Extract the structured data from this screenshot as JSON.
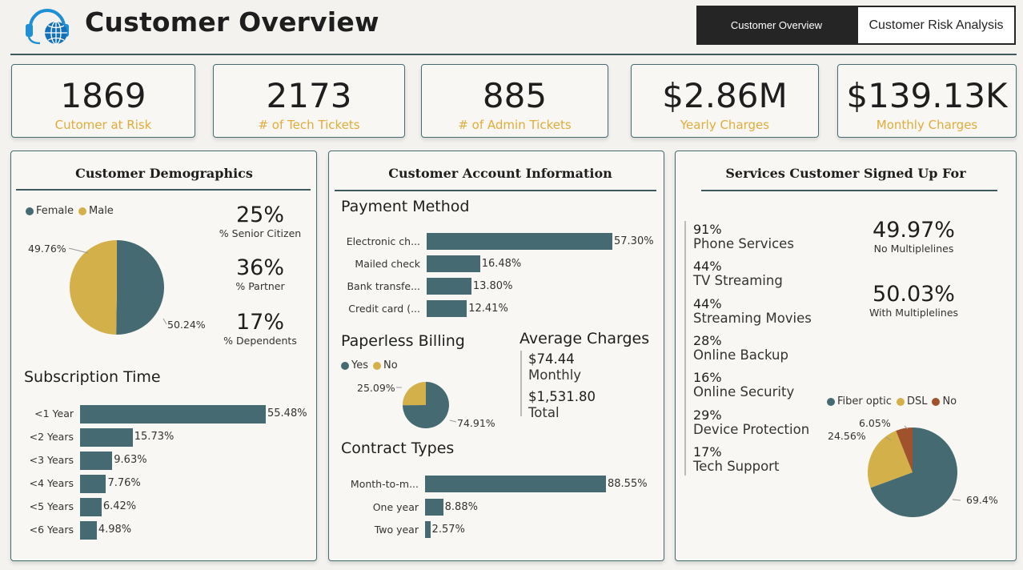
{
  "header": {
    "title": "Customer Overview",
    "nav": [
      {
        "label": "Customer Overview",
        "active": true
      },
      {
        "label": "Customer Risk Analysis",
        "active": false
      }
    ]
  },
  "colors": {
    "primary": "#456a72",
    "accent": "#d4b04a",
    "third": "#a0522d",
    "kpi_label": "#e0ac3a"
  },
  "kpis": [
    {
      "value": "1869",
      "label": "Cutomer at Risk"
    },
    {
      "value": "2173",
      "label": "# of Tech Tickets"
    },
    {
      "value": "885",
      "label": "# of Admin Tickets"
    },
    {
      "value": "$2.86M",
      "label": "Yearly Charges"
    },
    {
      "value": "$139.13K",
      "label": "Monthly Charges"
    }
  ],
  "demographics": {
    "title": "Customer Demographics",
    "legend": [
      "Female",
      "Male"
    ],
    "gender_pie": {
      "female": 50.24,
      "male": 49.76,
      "female_label": "50.24%",
      "male_label": "49.76%"
    },
    "stats": [
      {
        "value": "25%",
        "label": "% Senior Citizen"
      },
      {
        "value": "36%",
        "label": "% Partner"
      },
      {
        "value": "17%",
        "label": "% Dependents"
      }
    ],
    "subscription_title": "Subscription Time"
  },
  "account": {
    "title": "Customer Account Information",
    "payment_title": "Payment Method",
    "paperless_title": "Paperless Billing",
    "paperless_legend": [
      "Yes",
      "No"
    ],
    "paperless_pie": {
      "yes": 74.91,
      "no": 25.09,
      "yes_label": "74.91%",
      "no_label": "25.09%"
    },
    "avg_title": "Average Charges",
    "avg_monthly_value": "$74.44",
    "avg_monthly_label": "Monthly",
    "avg_total_value": "$1,531.80",
    "avg_total_label": "Total",
    "contract_title": "Contract Types"
  },
  "services": {
    "title": "Services Customer Signed Up For",
    "items": [
      {
        "pct": "91%",
        "name": "Phone Services"
      },
      {
        "pct": "44%",
        "name": "TV Streaming"
      },
      {
        "pct": "44%",
        "name": "Streaming Movies"
      },
      {
        "pct": "28%",
        "name": "Online Backup"
      },
      {
        "pct": "16%",
        "name": "Online Security"
      },
      {
        "pct": "29%",
        "name": "Device Protection"
      },
      {
        "pct": "17%",
        "name": "Tech Support"
      }
    ],
    "multi": [
      {
        "value": "49.97%",
        "label": "No Multiplelines"
      },
      {
        "value": "50.03%",
        "label": "With Multiplelines"
      }
    ],
    "internet_legend": [
      "Fiber optic",
      "DSL",
      "No"
    ],
    "internet_pie": {
      "fiber": 69.4,
      "dsl": 24.56,
      "no": 6.05,
      "fiber_label": "69.4%",
      "dsl_label": "24.56%",
      "no_label": "6.05%"
    }
  },
  "chart_data": [
    {
      "type": "bar",
      "title": "Subscription Time",
      "categories": [
        "<1 Year",
        "<2 Years",
        "<3 Years",
        "<4 Years",
        "<5 Years",
        "<6 Years"
      ],
      "values": [
        55.48,
        15.73,
        9.63,
        7.76,
        6.42,
        4.98
      ],
      "labels": [
        "55.48%",
        "15.73%",
        "9.63%",
        "7.76%",
        "6.42%",
        "4.98%"
      ]
    },
    {
      "type": "bar",
      "title": "Payment Method",
      "categories": [
        "Electronic ch...",
        "Mailed check",
        "Bank transfe...",
        "Credit card (..."
      ],
      "values": [
        57.3,
        16.48,
        13.8,
        12.41
      ],
      "labels": [
        "57.30%",
        "16.48%",
        "13.80%",
        "12.41%"
      ]
    },
    {
      "type": "bar",
      "title": "Contract Types",
      "categories": [
        "Month-to-m...",
        "One year",
        "Two year"
      ],
      "values": [
        88.55,
        8.88,
        2.57
      ],
      "labels": [
        "88.55%",
        "8.88%",
        "2.57%"
      ]
    }
  ]
}
